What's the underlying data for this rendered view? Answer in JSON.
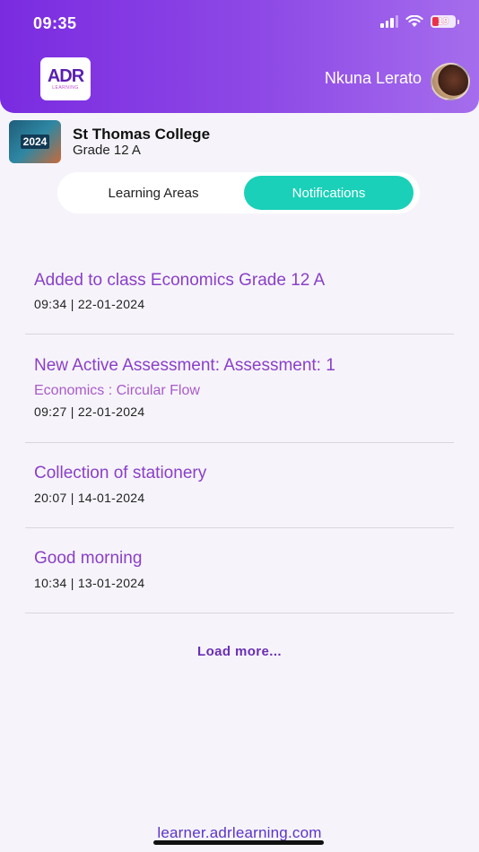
{
  "status_bar": {
    "time": "09:35",
    "battery": "19"
  },
  "header": {
    "logo_mark": "ADR",
    "logo_sub": "LEARNING",
    "user_name": "Nkuna Lerato"
  },
  "school": {
    "badge_text": "2024",
    "name": "St Thomas College",
    "grade": "Grade 12 A"
  },
  "tabs": [
    {
      "label": "Learning Areas",
      "active": false
    },
    {
      "label": "Notifications",
      "active": true
    }
  ],
  "notifications": [
    {
      "title": "Added to class Economics Grade 12 A",
      "time": "09:34",
      "date": "22-01-2024",
      "meta": "09:34  |  22-01-2024"
    },
    {
      "title": "New Active Assessment: Assessment: 1",
      "subtitle": "Economics : Circular Flow",
      "time": "09:27",
      "date": "22-01-2024",
      "meta": "09:27  |  22-01-2024"
    },
    {
      "title": "Collection of stationery",
      "time": "20:07",
      "date": "14-01-2024",
      "meta": "20:07  |  14-01-2024"
    },
    {
      "title": "Good morning",
      "time": "10:34",
      "date": "13-01-2024",
      "meta": "10:34  |  13-01-2024"
    }
  ],
  "load_more_label": "Load more...",
  "footer_url": "learner.adrlearning.com",
  "colors": {
    "header_start": "#7a2be0",
    "header_end": "#a56ded",
    "active_tab": "#1ad0b8",
    "notification_title": "#8a3fc9"
  }
}
